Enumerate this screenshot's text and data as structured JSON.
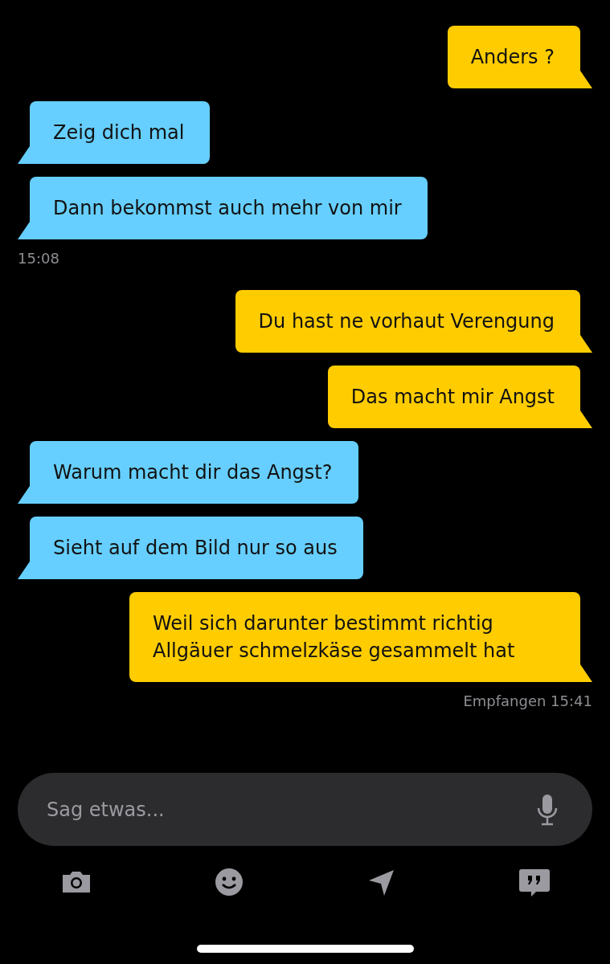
{
  "messages": [
    {
      "kind": "sent",
      "text": "Anders ?"
    },
    {
      "kind": "received",
      "text": "Zeig dich mal"
    },
    {
      "kind": "received",
      "text": "Dann bekommst auch mehr von mir",
      "footer": "15:08"
    },
    {
      "kind": "sent",
      "text": "Du hast ne vorhaut Verengung"
    },
    {
      "kind": "sent",
      "text": "Das macht mir Angst"
    },
    {
      "kind": "received",
      "text": "Warum macht dir das Angst?"
    },
    {
      "kind": "received",
      "text": "Sieht auf dem Bild nur so aus"
    },
    {
      "kind": "sent",
      "text": "Weil sich darunter bestimmt richtig Allgäuer schmelzkäse gesammelt hat",
      "footer": "Empfangen 15:41"
    }
  ],
  "composer": {
    "placeholder": "Sag etwas..."
  }
}
